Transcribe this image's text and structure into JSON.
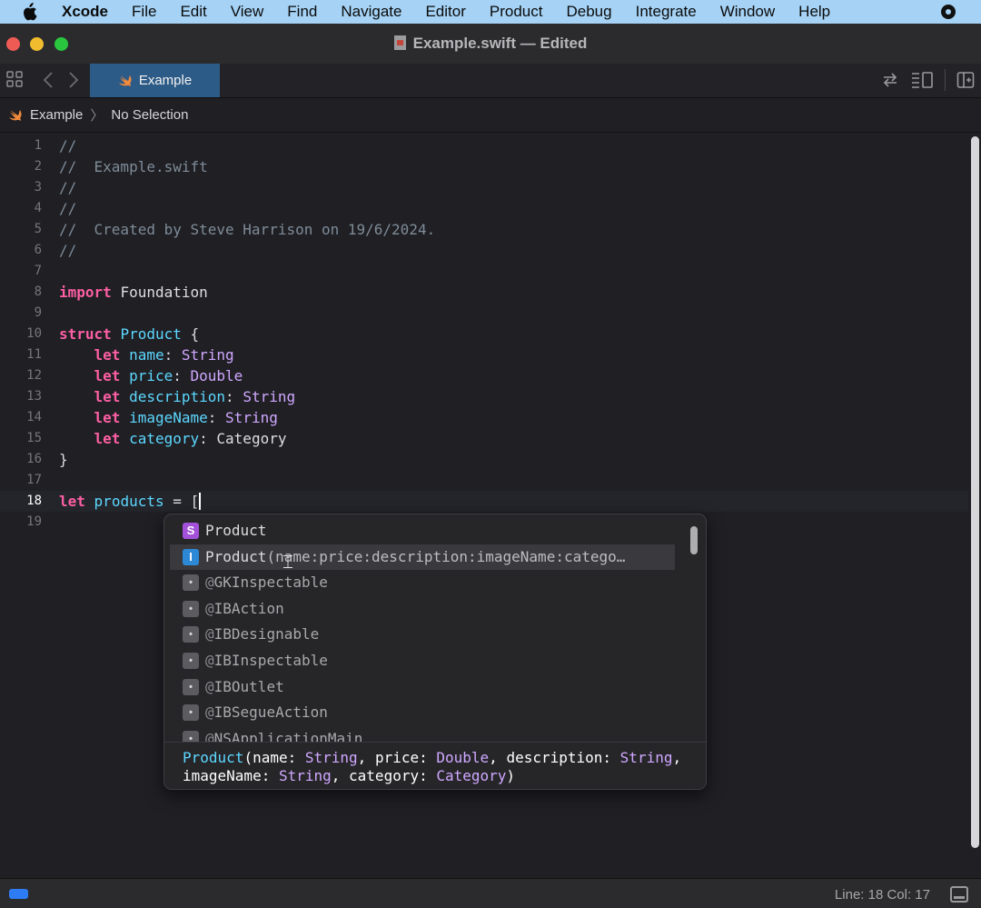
{
  "menubar": {
    "apple_icon": "apple-logo-icon",
    "app_name": "Xcode",
    "items": [
      "File",
      "Edit",
      "View",
      "Find",
      "Navigate",
      "Editor",
      "Product",
      "Debug",
      "Integrate",
      "Window",
      "Help"
    ],
    "record_icon": "screen-record-icon"
  },
  "window": {
    "title": "Example.swift — Edited",
    "colors": {
      "close": "#ee5b55",
      "minimize": "#f2bc2f",
      "zoom": "#2bc63f"
    }
  },
  "tabbar": {
    "tab_label": "Example",
    "tab_color": "#2d5b87"
  },
  "jumpbar": {
    "project": "Example",
    "selection": "No Selection"
  },
  "editor": {
    "current_line": 18,
    "lines": [
      "1",
      "2",
      "3",
      "4",
      "5",
      "6",
      "7",
      "8",
      "9",
      "10",
      "11",
      "12",
      "13",
      "14",
      "15",
      "16",
      "17",
      "18",
      "19"
    ],
    "comments": {
      "c1": "//",
      "c2": "//  Example.swift",
      "c3": "//",
      "c4": "//",
      "c5": "//  Created by Steve Harrison on 19/6/2024.",
      "c6": "//"
    },
    "import_kw": "import",
    "import_module": "Foundation",
    "struct_kw": "struct",
    "struct_name": "Product",
    "open_brace": "{",
    "close_brace": "}",
    "let_kw": "let",
    "props": [
      {
        "name": "name",
        "type": "String"
      },
      {
        "name": "price",
        "type": "Double"
      },
      {
        "name": "description",
        "type": "String"
      },
      {
        "name": "imageName",
        "type": "String"
      },
      {
        "name": "category",
        "type": "Category"
      }
    ],
    "products_var": "products",
    "assign": " = ["
  },
  "completion": {
    "items": [
      {
        "badge": "S",
        "kind": "struct",
        "text": "Product"
      },
      {
        "badge": "I",
        "kind": "init",
        "text": "Product",
        "args": "(name:price:description:imageName:catego…"
      },
      {
        "badge": "•",
        "kind": "attr",
        "at": "@",
        "text": "GKInspectable"
      },
      {
        "badge": "•",
        "kind": "attr",
        "at": "@",
        "text": "IBAction"
      },
      {
        "badge": "•",
        "kind": "attr",
        "at": "@",
        "text": "IBDesignable"
      },
      {
        "badge": "•",
        "kind": "attr",
        "at": "@",
        "text": "IBInspectable"
      },
      {
        "badge": "•",
        "kind": "attr",
        "at": "@",
        "text": "IBOutlet"
      },
      {
        "badge": "•",
        "kind": "attr",
        "at": "@",
        "text": "IBSegueAction"
      },
      {
        "badge": "•",
        "kind": "attr",
        "at": "@",
        "text": "NSApplicationMain"
      }
    ],
    "detail": {
      "fn": "Product",
      "p1": "(name: ",
      "t1": "String",
      "p2": ", price: ",
      "t2": "Double",
      "p3": ", description: ",
      "t3": "String",
      "p4": ", imageName: ",
      "t4": "String",
      "p5": ", category: ",
      "t5": "Category",
      "p6": ")"
    }
  },
  "statusbar": {
    "position": "Line: 18  Col: 17"
  }
}
